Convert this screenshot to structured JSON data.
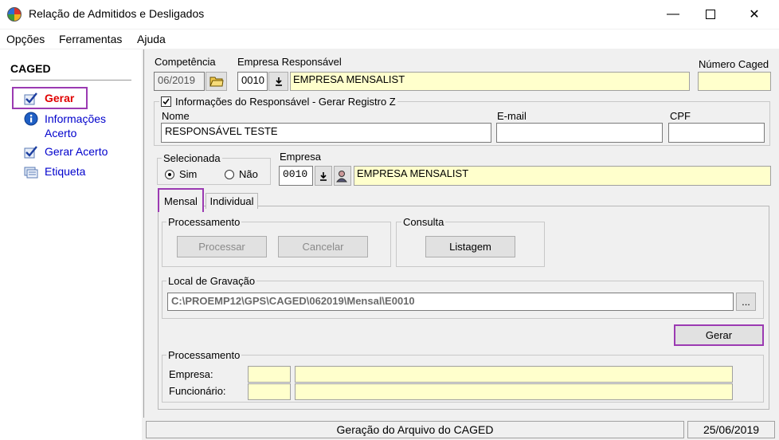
{
  "window": {
    "title": "Relação de Admitidos e Desligados",
    "min_glyph": "—",
    "close_glyph": "✕"
  },
  "menu": [
    "Opções",
    "Ferramentas",
    "Ajuda"
  ],
  "sidebar": {
    "title": "CAGED",
    "items": [
      {
        "label": "Gerar",
        "icon": "check-icon",
        "color": "#e00000"
      },
      {
        "label": "Informações Acerto",
        "icon": "info-icon",
        "color": "#0000cc"
      },
      {
        "label": "Gerar Acerto",
        "icon": "check-icon",
        "color": "#0000cc"
      },
      {
        "label": "Etiqueta",
        "icon": "label-icon",
        "color": "#0000cc"
      }
    ]
  },
  "header": {
    "competencia_label": "Competência",
    "competencia_value": "06/2019",
    "empresa_resp_label": "Empresa Responsável",
    "empresa_resp_code": "0010",
    "empresa_resp_name": "EMPRESA MENSALIST",
    "numero_caged_label": "Número Caged",
    "numero_caged_value": ""
  },
  "responsavel": {
    "checkbox_label": "Informações do Responsável - Gerar Registro Z",
    "checked": true,
    "nome_label": "Nome",
    "nome_value": "RESPONSÁVEL TESTE",
    "email_label": "E-mail",
    "email_value": "",
    "cpf_label": "CPF",
    "cpf_value": ""
  },
  "selecionada": {
    "label": "Selecionada",
    "sim_label": "Sim",
    "nao_label": "Não",
    "selected": "Sim"
  },
  "empresa": {
    "label": "Empresa",
    "code": "0010",
    "name": "EMPRESA MENSALIST"
  },
  "tabs": [
    {
      "label": "Mensal",
      "active": true
    },
    {
      "label": "Individual",
      "active": false
    }
  ],
  "processamento": {
    "group_label": "Processamento",
    "processar_label": "Processar",
    "cancelar_label": "Cancelar"
  },
  "consulta": {
    "group_label": "Consulta",
    "listagem_label": "Listagem"
  },
  "gravacao": {
    "group_label": "Local de Gravação",
    "path": "C:\\PROEMP12\\GPS\\CAGED\\062019\\Mensal\\E0010",
    "browse_label": "..."
  },
  "gerar_button": "Gerar",
  "processamento2": {
    "group_label": "Processamento",
    "empresa_label": "Empresa:",
    "funcionario_label": "Funcionário:"
  },
  "status": {
    "message": "Geração do Arquivo do CAGED",
    "date": "25/06/2019"
  },
  "colors": {
    "accent_purple": "#9b3ab2",
    "yellow_field": "#ffffcc",
    "link_blue": "#0000cc",
    "gerar_red": "#e00000"
  }
}
